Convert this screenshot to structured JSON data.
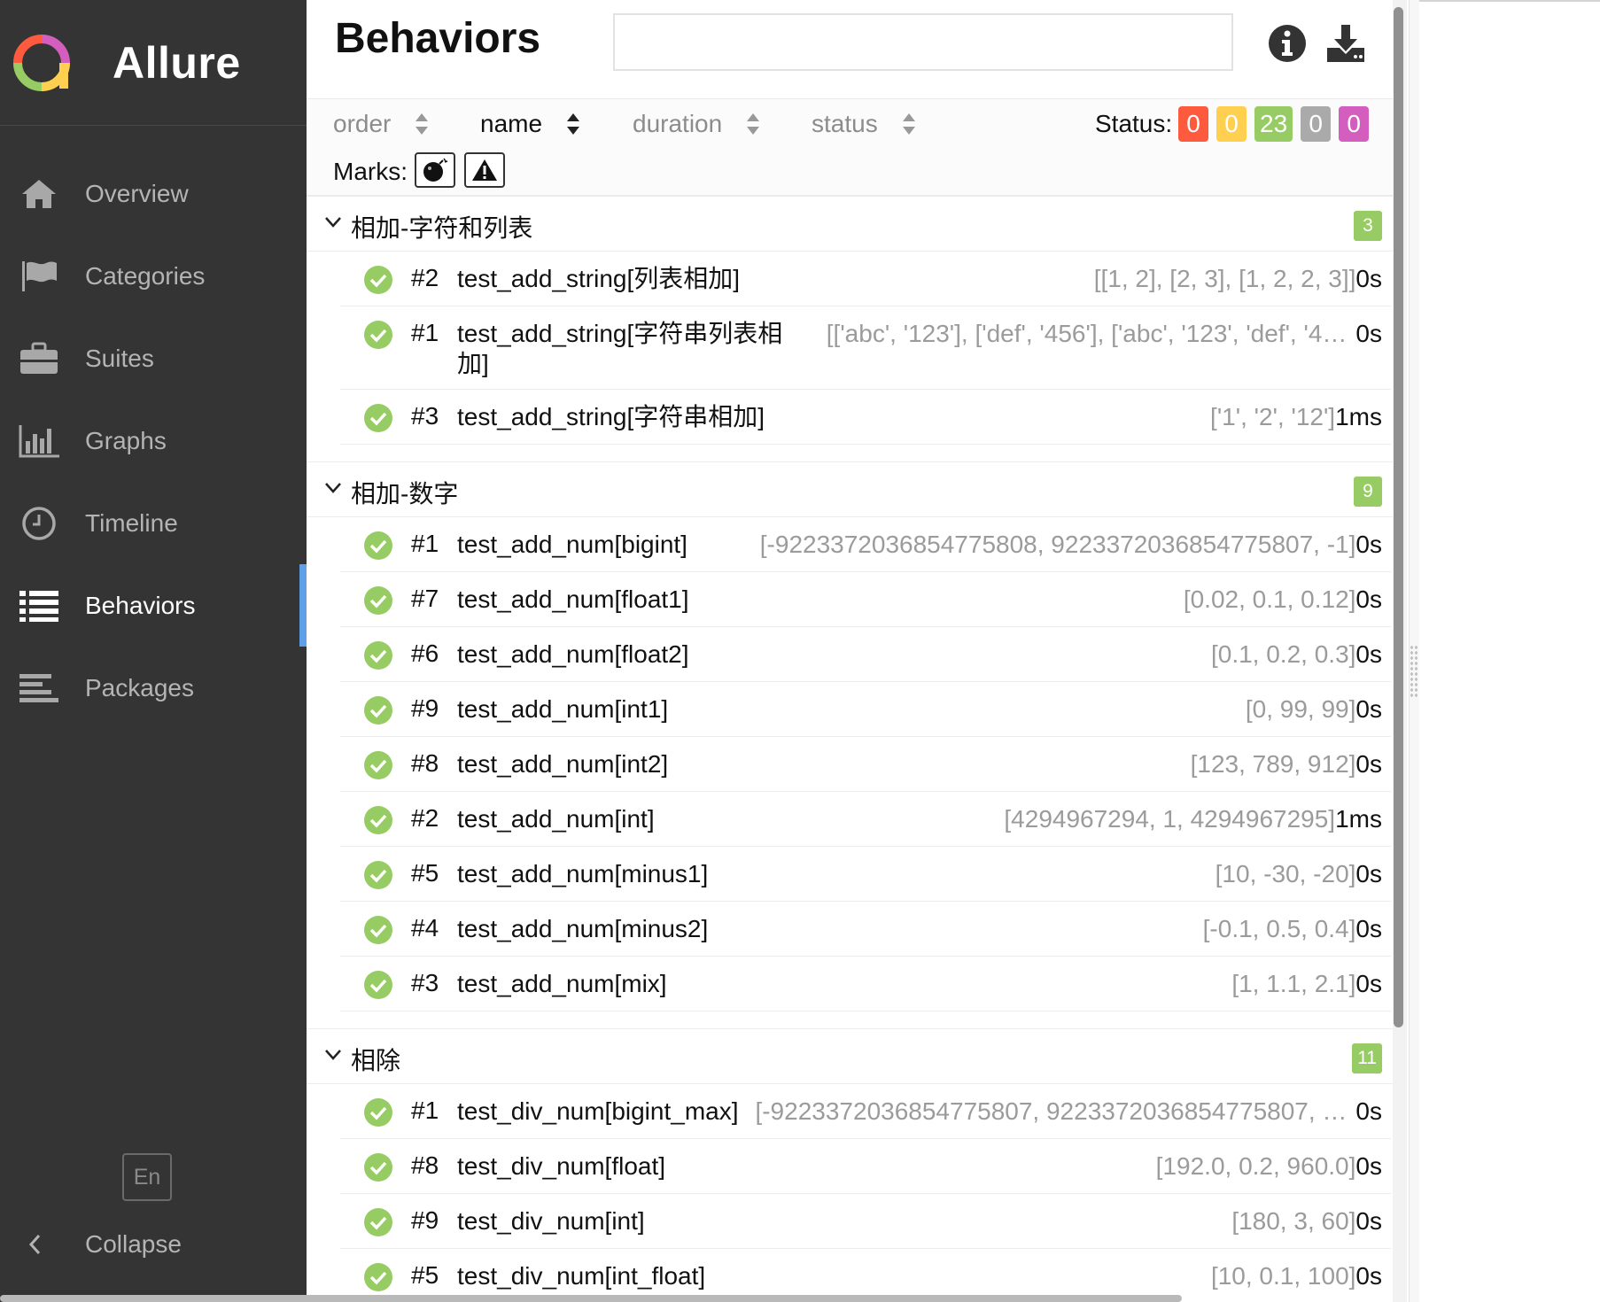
{
  "app": {
    "name": "Allure"
  },
  "sidebar": {
    "items": [
      {
        "label": "Overview",
        "icon": "home-icon"
      },
      {
        "label": "Categories",
        "icon": "flag-icon"
      },
      {
        "label": "Suites",
        "icon": "briefcase-icon"
      },
      {
        "label": "Graphs",
        "icon": "bar-chart-icon"
      },
      {
        "label": "Timeline",
        "icon": "clock-icon"
      },
      {
        "label": "Behaviors",
        "icon": "list-icon",
        "active": true
      },
      {
        "label": "Packages",
        "icon": "align-left-icon"
      }
    ],
    "language": "En",
    "collapse_label": "Collapse"
  },
  "header": {
    "title": "Behaviors",
    "search": {
      "value": "",
      "placeholder": ""
    }
  },
  "sort": {
    "order": "order",
    "name": "name",
    "duration": "duration",
    "status": "status",
    "active": "name"
  },
  "status_filter": {
    "label": "Status:",
    "counts": [
      {
        "status": "failed",
        "value": "0",
        "color": "#fd5a3e"
      },
      {
        "status": "broken",
        "value": "0",
        "color": "#ffd050"
      },
      {
        "status": "passed",
        "value": "23",
        "color": "#97cc64"
      },
      {
        "status": "skipped",
        "value": "0",
        "color": "#aaaaaa"
      },
      {
        "status": "unknown",
        "value": "0",
        "color": "#d35ebe"
      }
    ]
  },
  "marks": {
    "label": "Marks:",
    "items": [
      "flaky-bomb-icon",
      "warning-icon"
    ]
  },
  "groups": [
    {
      "title": "相加-字符和列表",
      "count": "3",
      "tests": [
        {
          "num": "#2",
          "name": "test_add_string[列表相加]",
          "params": "[[1, 2], [2, 3], [1, 2, 2, 3]]",
          "duration": "0s"
        },
        {
          "num": "#1",
          "name": "test_add_string[字符串列表相加]",
          "params": "[['abc', '123'], ['def', '456'], ['abc', '123', 'def', '4…",
          "duration": "0s"
        },
        {
          "num": "#3",
          "name": "test_add_string[字符串相加]",
          "params": "['1', '2', '12']",
          "duration": "1ms"
        }
      ]
    },
    {
      "title": "相加-数字",
      "count": "9",
      "tests": [
        {
          "num": "#1",
          "name": "test_add_num[bigint]",
          "params": "[-9223372036854775808, 9223372036854775807, -1]",
          "duration": "0s"
        },
        {
          "num": "#7",
          "name": "test_add_num[float1]",
          "params": "[0.02, 0.1, 0.12]",
          "duration": "0s"
        },
        {
          "num": "#6",
          "name": "test_add_num[float2]",
          "params": "[0.1, 0.2, 0.3]",
          "duration": "0s"
        },
        {
          "num": "#9",
          "name": "test_add_num[int1]",
          "params": "[0, 99, 99]",
          "duration": "0s"
        },
        {
          "num": "#8",
          "name": "test_add_num[int2]",
          "params": "[123, 789, 912]",
          "duration": "0s"
        },
        {
          "num": "#2",
          "name": "test_add_num[int]",
          "params": "[4294967294, 1, 4294967295]",
          "duration": "1ms"
        },
        {
          "num": "#5",
          "name": "test_add_num[minus1]",
          "params": "[10, -30, -20]",
          "duration": "0s"
        },
        {
          "num": "#4",
          "name": "test_add_num[minus2]",
          "params": "[-0.1, 0.5, 0.4]",
          "duration": "0s"
        },
        {
          "num": "#3",
          "name": "test_add_num[mix]",
          "params": "[1, 1.1, 2.1]",
          "duration": "0s"
        }
      ]
    },
    {
      "title": "相除",
      "count": "11",
      "tests": [
        {
          "num": "#1",
          "name": "test_div_num[bigint_max]",
          "params": "[-9223372036854775807, 9223372036854775807, …",
          "duration": "0s"
        },
        {
          "num": "#8",
          "name": "test_div_num[float]",
          "params": "[192.0, 0.2, 960.0]",
          "duration": "0s"
        },
        {
          "num": "#9",
          "name": "test_div_num[int]",
          "params": "[180, 3, 60]",
          "duration": "0s"
        },
        {
          "num": "#5",
          "name": "test_div_num[int_float]",
          "params": "[10, 0.1, 100]",
          "duration": "0s"
        }
      ]
    }
  ]
}
